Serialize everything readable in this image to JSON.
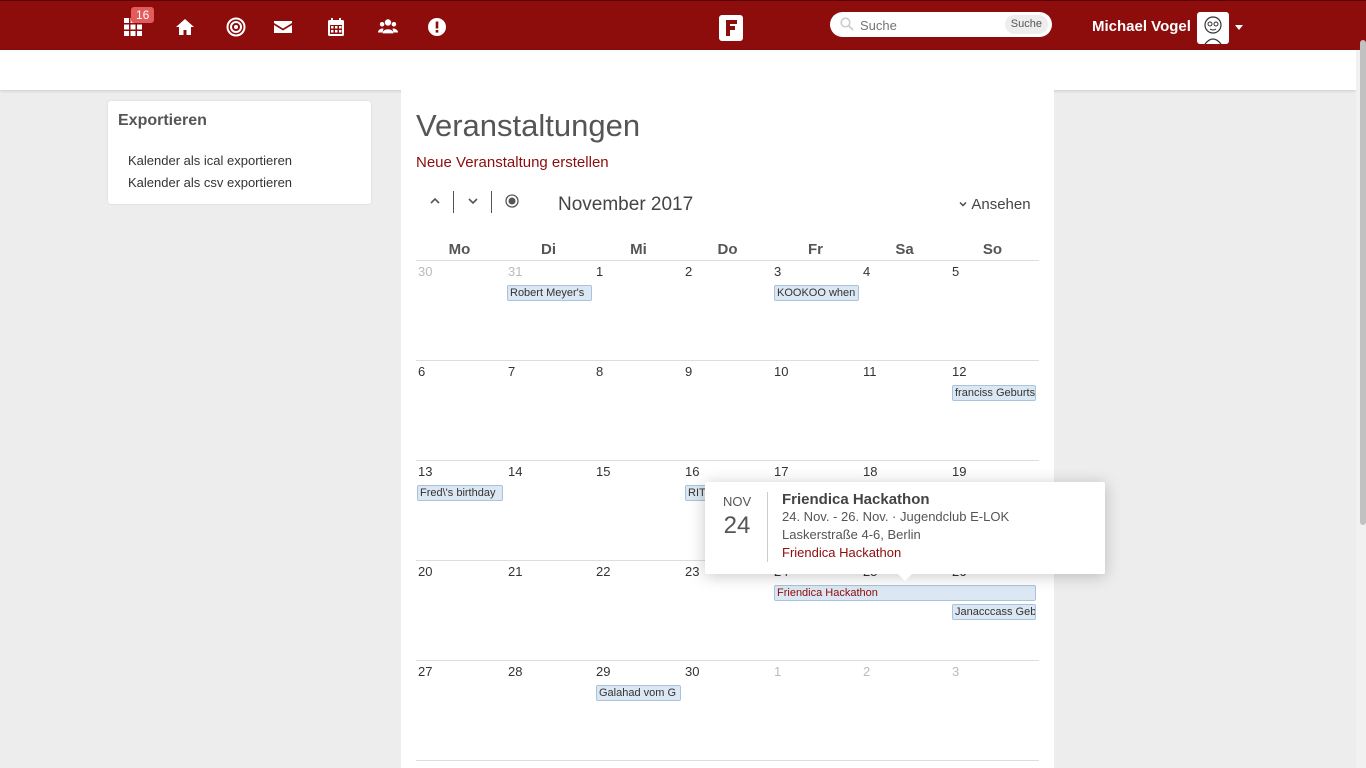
{
  "nav": {
    "badge_count": "16",
    "icons": [
      "apps-icon",
      "home-icon",
      "network-icon",
      "mail-icon",
      "calendar-icon",
      "contacts-icon",
      "notifications-icon"
    ]
  },
  "search": {
    "placeholder": "Suche",
    "button_label": "Suche"
  },
  "user": {
    "name": "Michael Vogel"
  },
  "aside": {
    "title": "Exportieren",
    "links": [
      "Kalender als ical exportieren",
      "Kalender als csv exportieren"
    ]
  },
  "main": {
    "title": "Veranstaltungen",
    "new_event": "Neue Veranstaltung erstellen",
    "month": "November 2017",
    "view_label": "Ansehen"
  },
  "calendar": {
    "weekdays": [
      "Mo",
      "Di",
      "Mi",
      "Do",
      "Fr",
      "Sa",
      "So"
    ],
    "weeks": [
      [
        "30",
        "31",
        "1",
        "2",
        "3",
        "4",
        "5"
      ],
      [
        "6",
        "7",
        "8",
        "9",
        "10",
        "11",
        "12"
      ],
      [
        "13",
        "14",
        "15",
        "16",
        "17",
        "18",
        "19"
      ],
      [
        "20",
        "21",
        "22",
        "23",
        "24",
        "25",
        "26"
      ],
      [
        "27",
        "28",
        "29",
        "30",
        "1",
        "2",
        "3"
      ]
    ],
    "events": [
      "Robert Meyer's",
      "KOOKOO when",
      "franciss Geburts",
      "Fred\\'s birthday",
      "RITU",
      "Friendica Hackathon",
      "Janacccass Gebu",
      "Galahad vom G"
    ]
  },
  "popup": {
    "month": "NOV",
    "day": "24",
    "title": "Friendica Hackathon",
    "date_location": "24. Nov. - 26. Nov. · Jugendclub E-LOK",
    "address": "Laskerstraße 4-6, Berlin",
    "link": "Friendica Hackathon"
  },
  "colors": {
    "brand": "#8d0c0c",
    "event_bg": "#dbe7f2",
    "badge": "#e35b5b"
  }
}
